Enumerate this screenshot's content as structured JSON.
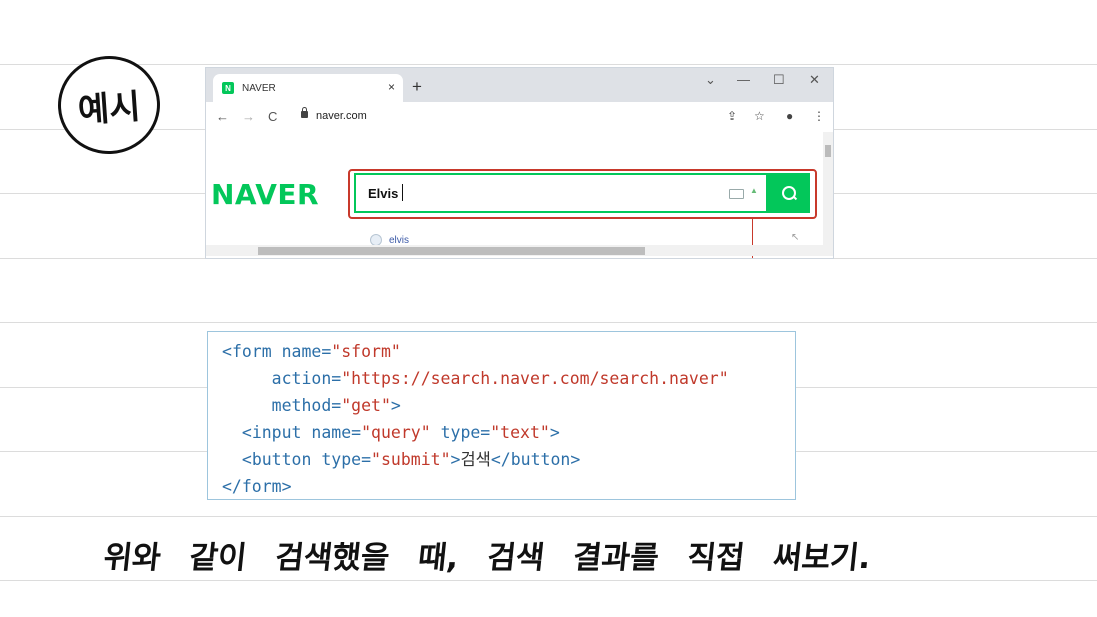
{
  "badge": {
    "label": "예시"
  },
  "browser": {
    "tab": {
      "title": "NAVER",
      "favicon_letter": "N",
      "close": "×"
    },
    "new_tab": "+",
    "window_controls": {
      "dropdown": "⌄",
      "minimize": "—",
      "maximize": "☐",
      "close": "✕"
    },
    "nav": {
      "back": "←",
      "forward": "→",
      "reload": "C"
    },
    "address": {
      "url": "naver.com"
    },
    "toolbar_icons": {
      "share": "⇪",
      "star": "☆",
      "profile": "●",
      "menu": "⋮"
    },
    "page": {
      "logo": "NAVER",
      "search": {
        "value": "Elvis"
      },
      "suggestion": "elvis",
      "suggestion_arrow": "↖"
    },
    "colors": {
      "brand": "#03c75a",
      "highlight": "#c8392b"
    }
  },
  "code": {
    "lines": [
      [
        {
          "t": "<",
          "c": "tag"
        },
        {
          "t": "form",
          "c": "tag"
        },
        {
          "t": " name=",
          "c": "attr"
        },
        {
          "t": "\"sform\"",
          "c": "str"
        }
      ],
      [
        {
          "t": "     action=",
          "c": "attr"
        },
        {
          "t": "\"https://search.naver.com/search.naver\"",
          "c": "str"
        }
      ],
      [
        {
          "t": "     method=",
          "c": "attr"
        },
        {
          "t": "\"get\"",
          "c": "str"
        },
        {
          "t": ">",
          "c": "tag"
        }
      ],
      [
        {
          "t": "  <",
          "c": "tag"
        },
        {
          "t": "input",
          "c": "tag"
        },
        {
          "t": " name=",
          "c": "attr"
        },
        {
          "t": "\"query\"",
          "c": "str"
        },
        {
          "t": " type=",
          "c": "attr"
        },
        {
          "t": "\"text\"",
          "c": "str"
        },
        {
          "t": ">",
          "c": "tag"
        }
      ],
      [
        {
          "t": "  <",
          "c": "tag"
        },
        {
          "t": "button",
          "c": "tag"
        },
        {
          "t": " type=",
          "c": "attr"
        },
        {
          "t": "\"submit\"",
          "c": "str"
        },
        {
          "t": ">",
          "c": "tag"
        },
        {
          "t": "검색",
          "c": "plain"
        },
        {
          "t": "</",
          "c": "tag"
        },
        {
          "t": "button",
          "c": "tag"
        },
        {
          "t": ">",
          "c": "tag"
        }
      ],
      [
        {
          "t": "</",
          "c": "tag"
        },
        {
          "t": "form",
          "c": "tag"
        },
        {
          "t": ">",
          "c": "tag"
        }
      ]
    ]
  },
  "note": {
    "text": "위와 같이 검색했을 때, 검색 결과를 직접 써보기."
  }
}
